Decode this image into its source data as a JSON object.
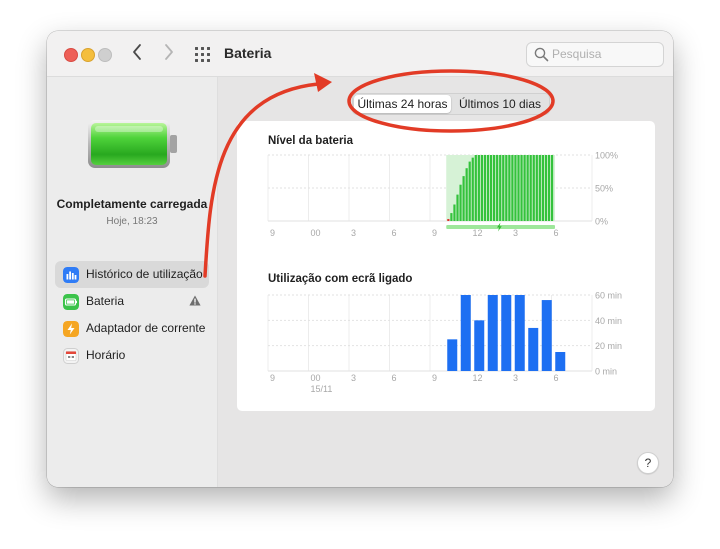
{
  "window": {
    "title": "Bateria",
    "search_placeholder": "Pesquisa",
    "help_label": "?"
  },
  "sidebar": {
    "status_title": "Completamente carregada",
    "status_time": "Hoje, 18:23",
    "items": [
      {
        "label": "Histórico de utilização",
        "icon": "bar-chart-icon",
        "color": "#2f7cf6",
        "selected": true
      },
      {
        "label": "Bateria",
        "icon": "battery-icon",
        "color": "#3bc34a",
        "warning": true
      },
      {
        "label": "Adaptador de corrente",
        "icon": "bolt-icon",
        "color": "#f5a623"
      },
      {
        "label": "Horário",
        "icon": "calendar-icon",
        "color": "#e8e8e8"
      }
    ]
  },
  "tabs": [
    {
      "label": "Últimas 24 horas",
      "active": true
    },
    {
      "label": "Últimos 10 dias",
      "active": false
    }
  ],
  "chart_data": [
    {
      "type": "bar",
      "title": "Nível da bateria",
      "x_tick_labels": [
        "9",
        "00",
        "3",
        "6",
        "9",
        "12",
        "3",
        "6"
      ],
      "y_tick_labels": [
        "100%",
        "50%",
        "0%"
      ],
      "ylim": [
        0,
        100
      ],
      "unit": "%",
      "values": [
        3,
        12,
        25,
        40,
        55,
        68,
        80,
        90,
        96,
        100,
        100,
        100,
        100,
        100,
        100,
        100,
        100,
        100,
        100,
        100,
        100,
        100,
        100,
        100,
        100,
        100,
        100,
        100,
        100,
        100,
        100,
        100,
        100,
        100,
        100
      ],
      "low_color": "#e0322e",
      "bar_color": "#34c23c",
      "charging_background": "#d6f2d6",
      "charging_strip_color": "#9ee79b"
    },
    {
      "type": "bar",
      "title": "Utilização com ecrã ligado",
      "x_tick_labels": [
        "9",
        "00",
        "3",
        "6",
        "9",
        "12",
        "3",
        "6"
      ],
      "date_label": "15/11",
      "y_tick_labels": [
        "60 min",
        "40 min",
        "20 min",
        "0 min"
      ],
      "ylim": [
        0,
        60
      ],
      "unit": "min",
      "values": [
        25,
        60,
        40,
        60,
        60,
        60,
        34,
        56,
        15
      ],
      "bar_color": "#1d6ff2"
    }
  ],
  "annotation": {
    "color": "#e23b26"
  }
}
